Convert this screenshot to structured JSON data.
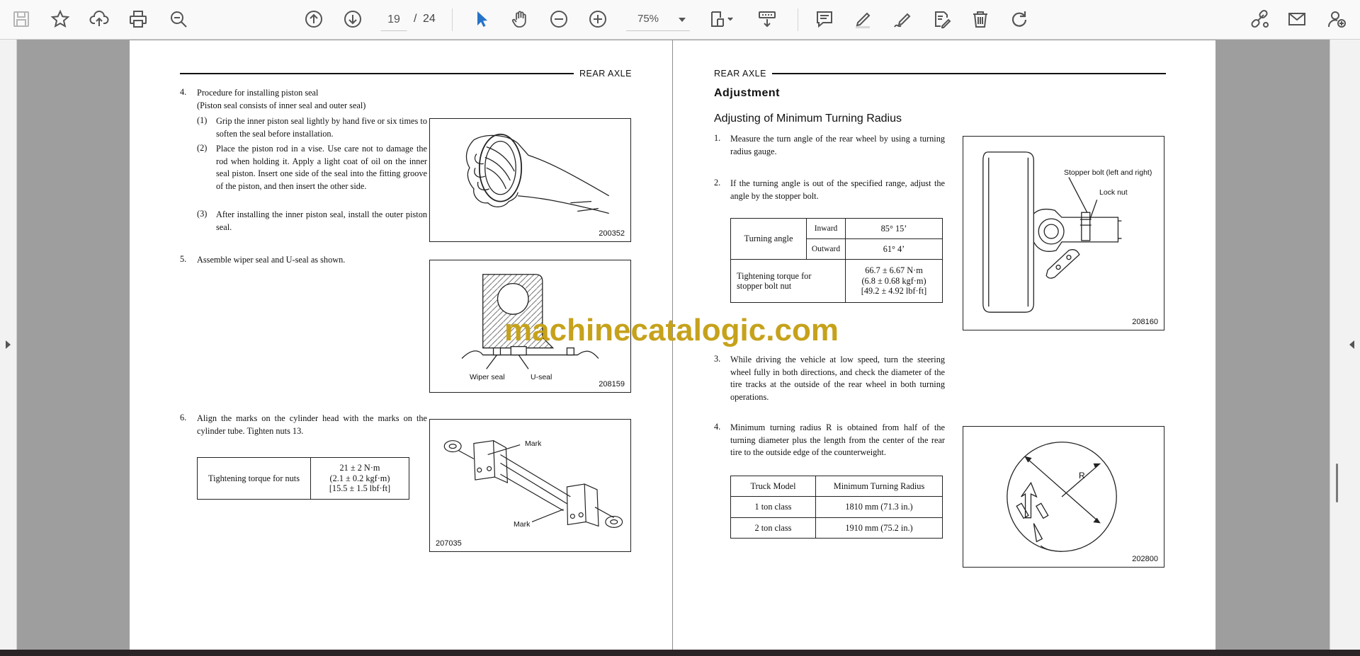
{
  "toolbar": {
    "page_current": "19",
    "page_separator": "/",
    "page_total": "24",
    "zoom": "75%"
  },
  "left_page": {
    "header": "REAR AXLE",
    "step4": {
      "num": "4.",
      "title": "Procedure for installing piston seal",
      "subtitle": "(Piston seal consists of inner seal and outer seal)",
      "items": [
        {
          "num": "(1)",
          "text": "Grip the inner piston seal lightly by hand five or six times to soften the seal before installation."
        },
        {
          "num": "(2)",
          "text": "Place the piston rod in a vise. Use care not to damage the rod when holding it. Apply a light coat of oil on the inner seal piston. Insert one side of the seal into the fitting groove of the piston, and then insert the other side."
        },
        {
          "num": "(3)",
          "text": "After installing the inner piston seal, install the outer piston seal."
        }
      ],
      "figure": "200352"
    },
    "step5": {
      "num": "5.",
      "text": "Assemble wiper seal and U-seal as shown.",
      "figure": "208159",
      "label_wiper": "Wiper seal",
      "label_useal": "U-seal"
    },
    "step6": {
      "num": "6.",
      "text": "Align the marks on the cylinder head with the marks on the cylinder tube. Tighten nuts 13.",
      "figure": "207035",
      "label_mark1": "Mark",
      "label_mark2": "Mark",
      "table": {
        "label": "Tightening torque for nuts",
        "value1": "21 ± 2 N·m",
        "value2": "(2.1 ± 0.2 kgf·m)",
        "value3": "[15.5 ± 1.5 lbf·ft]"
      }
    }
  },
  "right_page": {
    "header": "REAR AXLE",
    "section_title": "Adjustment",
    "subsection_title": "Adjusting of Minimum Turning Radius",
    "step1": {
      "num": "1.",
      "text": "Measure the turn angle of the rear wheel by using a turning radius gauge."
    },
    "step2": {
      "num": "2.",
      "text": "If the turning angle is out of the specified range, adjust the angle by the stopper bolt."
    },
    "figure_stopper": {
      "number": "208160",
      "label_stopper": "Stopper bolt (left and right)",
      "label_locknut": "Lock nut"
    },
    "angle_table": {
      "turning_angle": "Turning angle",
      "inward": "Inward",
      "inward_value": "85° 15’",
      "outward": "Outward",
      "outward_value": "61° 4’",
      "torque_label1": "Tightening torque for",
      "torque_label2": "stopper bolt nut",
      "torque_value1": "66.7 ± 6.67 N·m",
      "torque_value2": "(6.8 ± 0.68 kgf·m)",
      "torque_value3": "[49.2 ± 4.92 lbf·ft]"
    },
    "step3": {
      "num": "3.",
      "text": "While driving the vehicle at low speed, turn the steering wheel fully in both directions, and check the diameter of the tire tracks at the outside of the rear wheel in both turning operations."
    },
    "step4": {
      "num": "4.",
      "text": "Minimum turning radius R is obtained from half of the turning diameter plus the length from the center of the rear tire to the outside edge of the counterweight."
    },
    "figure_radius": {
      "number": "202800",
      "label_r": "R"
    },
    "radius_table": {
      "col1": "Truck Model",
      "col2": "Minimum Turning Radius",
      "rows": [
        {
          "model": "1 ton class",
          "radius": "1810 mm (71.3 in.)"
        },
        {
          "model": "2 ton class",
          "radius": "1910 mm (75.2 in.)"
        }
      ]
    }
  },
  "watermark": "machinecatalogic.com"
}
